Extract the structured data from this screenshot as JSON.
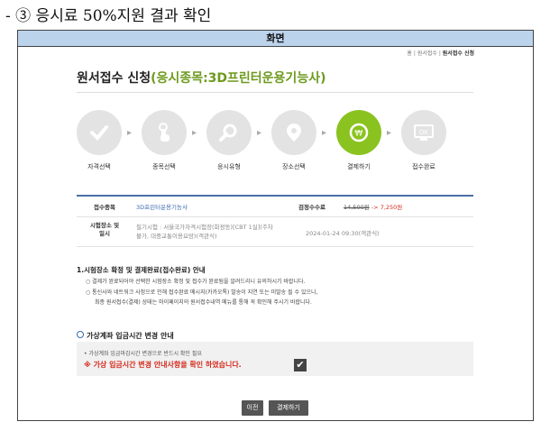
{
  "doc_heading": "- ③ 응시료 50%지원 결과 확인",
  "frame_title": "화면",
  "breadcrumb": {
    "home": "홈",
    "sep1": "|",
    "item1": "원서접수",
    "sep2": "|",
    "current": "원서접수 신청"
  },
  "page_title": {
    "main": "원서접수 신청",
    "sub": "(응시종목:3D프린터운용기능사)"
  },
  "steps": [
    {
      "label": "자격선택",
      "icon": "check-icon"
    },
    {
      "label": "종목선택",
      "icon": "hand-pointer-icon"
    },
    {
      "label": "응시유형",
      "icon": "magnifier-icon"
    },
    {
      "label": "장소선택",
      "icon": "location-pin-icon"
    },
    {
      "label": "결제하기",
      "icon": "coin-icon"
    },
    {
      "label": "접수완료",
      "icon": "ok-monitor-icon"
    }
  ],
  "info": {
    "item_label": "접수종목",
    "item_value": "3D프린터운용기능사",
    "fee_label": "검정수수료",
    "fee_old": "14,500원",
    "fee_arrow": "->",
    "fee_new": "7,250원",
    "place_label_1": "시험장소 및",
    "place_label_2": "일시",
    "place_line1": "필기시험 : 서울국가자격시험장(화정동)[CBT 1실](주차",
    "place_line2": "불가, 대중교통이용요망)(객관식)",
    "datetime": "2024-01-24 09:30(객관식)"
  },
  "notice": {
    "title": "1.시험장소 확정 및 결제완료(접수완료) 안내",
    "item1": "○ 결제가 완료되어야 선택한 시험장소 확정 및 접수가 완료됨을 알려드리니 유의하시기 바랍니다.",
    "item2": "○ 통신사와 네트워크 사정으로 인해 접수완료 메시지(카카오톡) 발송이 지연 또는 미발송 될 수 있으니,",
    "item3": "최종 원서접수(결제) 상태는 마이페이지의 원서접수내역 메뉴를 통해 꼭 확인해 주시기 바랍니다."
  },
  "virtual": {
    "title": "가상계좌 입금시간 변경 안내",
    "line1": "• 가상계좌 입금마감시간 변경으로 반드시 확인 필요",
    "line2": "※ 가상 입금시간 변경 안내사항을 확인 하였습니다.",
    "checkbox_checked": true
  },
  "buttons": {
    "prev": "이전",
    "pay": "결제하기"
  },
  "colors": {
    "accent_green": "#8ac320",
    "title_sub": "#6e9a1e",
    "link_blue": "#3a6ab0",
    "warning_red": "#d52b1e",
    "frame_header": "#bcd3ec"
  }
}
